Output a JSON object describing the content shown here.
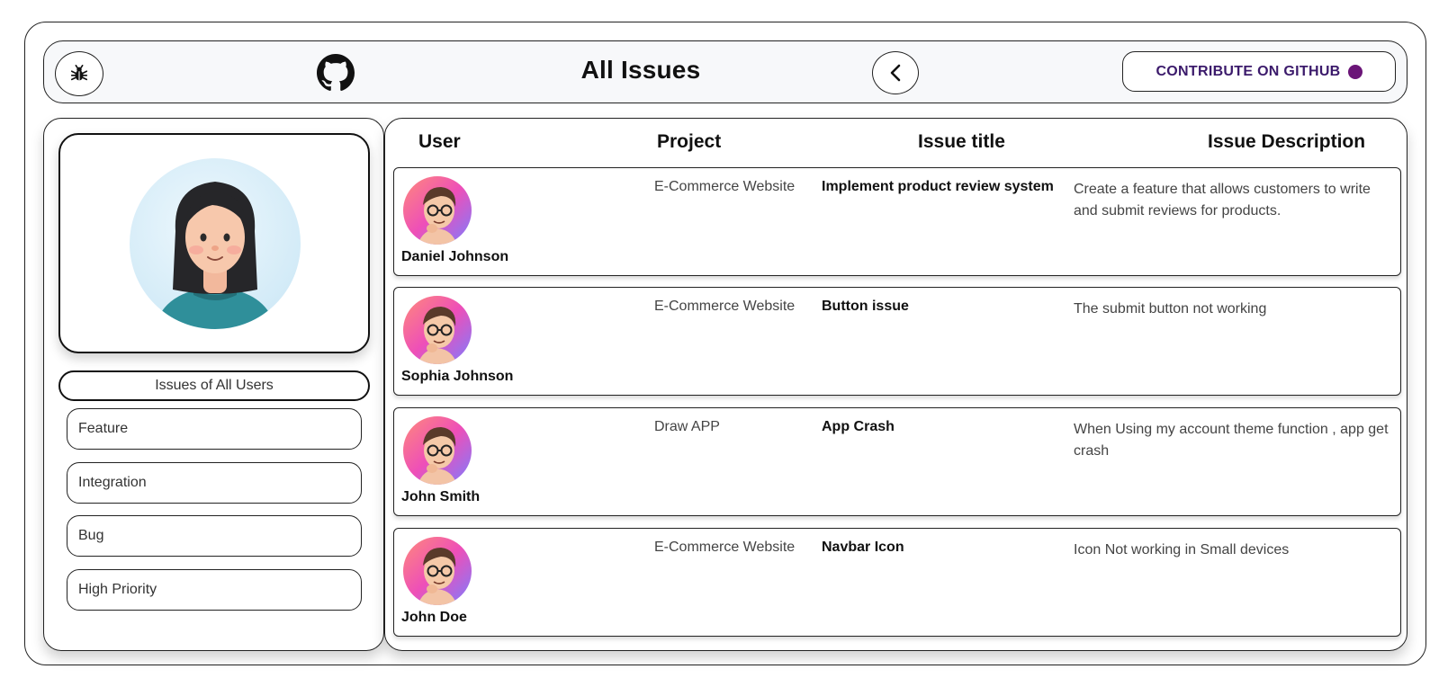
{
  "header": {
    "title": "All Issues",
    "contribute_label": "CONTRIBUTE ON GITHUB",
    "icons": {
      "bug": "bug-icon",
      "github": "github-icon",
      "back": "chevron-left-icon"
    }
  },
  "sidebar": {
    "all_users_label": "Issues of All Users",
    "filters": [
      {
        "label": "Feature"
      },
      {
        "label": "Integration"
      },
      {
        "label": "Bug"
      },
      {
        "label": "High Priority"
      }
    ]
  },
  "table": {
    "headers": {
      "user": "User",
      "project": "Project",
      "title": "Issue title",
      "description": "Issue Description"
    },
    "rows": [
      {
        "user": "Daniel Johnson",
        "project": "E-Commerce Website",
        "title": "Implement product review system",
        "description": "Create a feature that allows customers to write and submit reviews for products."
      },
      {
        "user": "Sophia Johnson",
        "project": "E-Commerce Website",
        "title": "Button issue",
        "description": "The submit button not working"
      },
      {
        "user": "John Smith",
        "project": "Draw APP",
        "title": "App Crash",
        "description": "When Using my account theme function , app get crash"
      },
      {
        "user": "John Doe",
        "project": "E-Commerce Website",
        "title": "Navbar Icon",
        "description": "Icon Not working in Small devices"
      }
    ]
  },
  "colors": {
    "accent_dot": "#6b1578",
    "contribute_text": "#3b1a6b"
  }
}
